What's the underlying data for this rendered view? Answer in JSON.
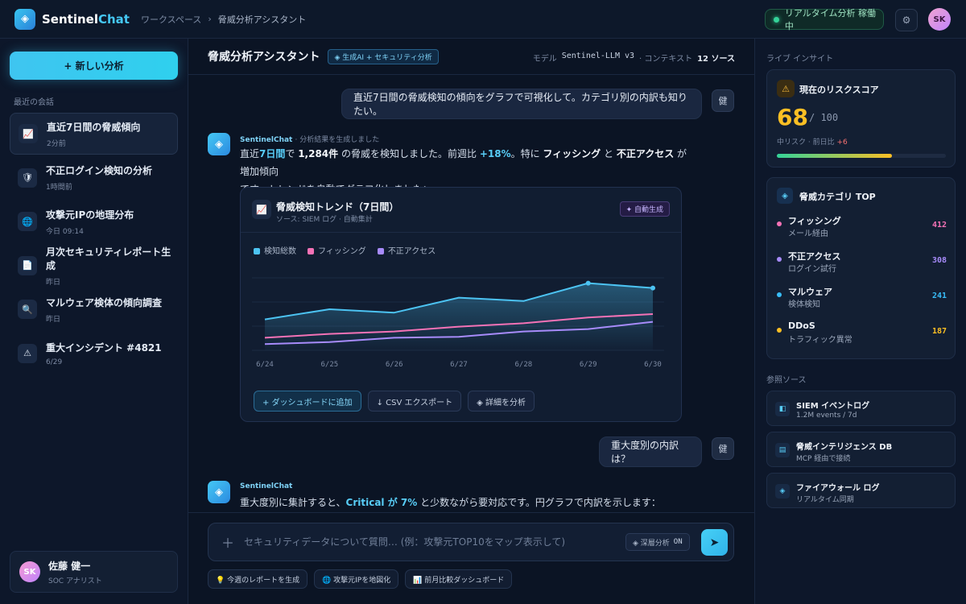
{
  "topbar": {
    "brand_main": "Sentinel",
    "brand_accent": "Chat",
    "breadcrumb": [
      "ワークスペース",
      "脅威分析アシスタント"
    ],
    "breadcrumb_sep": "›",
    "live_status": "リアルタイム分析 稼働中",
    "avatar_initials": "SK"
  },
  "sidebar": {
    "new_button": "+ 新しい分析",
    "section_label": "最近の会話",
    "conversations": [
      {
        "title": "直近7日間の脅威傾向",
        "time": "2分前",
        "icon": "chart-icon",
        "active": true
      },
      {
        "title": "不正ログイン検知の分析",
        "time": "1時間前",
        "icon": "shield-icon"
      },
      {
        "title": "攻撃元IPの地理分布",
        "time": "今日 09:14",
        "icon": "globe-icon"
      },
      {
        "title": "月次セキュリティレポート生成",
        "time": "昨日",
        "icon": "document-icon"
      },
      {
        "title": "マルウェア検体の傾向調査",
        "time": "昨日",
        "icon": "magnifier-icon"
      },
      {
        "title": "重大インシデント #4821",
        "time": "6/29",
        "icon": "warning-icon"
      }
    ],
    "user": {
      "initials": "SK",
      "name": "佐藤 健一",
      "role": "SOC アナリスト"
    }
  },
  "header": {
    "title": "脅威分析アシスタント",
    "badge": "◈ 生成AI + セキュリティ分析",
    "model_label": "モデル",
    "model_name": "Sentinel-LLM v3",
    "context_label": "· コンテキスト",
    "context_count": "12 ソース"
  },
  "messages": {
    "user1": "直近7日間の脅威検知の傾向をグラフで可視化して。カテゴリ別の内訳も知りたい。",
    "user_avatar": "健",
    "ai1_name": "SentinelChat",
    "ai1_sub": "· 分析結果を生成しました",
    "ai1_line1": {
      "a": "直近",
      "b": "7日間",
      "c": "で ",
      "d": "1,284件",
      "e": " の脅威を検知しました。前週比 ",
      "f": "+18%",
      "g": "。特に ",
      "h": "フィッシング",
      "i": " と ",
      "j": "不正アクセス",
      "k": " が増加傾向"
    },
    "ai1_line2": "です。トレンドを自動でグラフ化しました：",
    "user2": "重大度別の内訳は？",
    "ai2_name": "SentinelChat",
    "ai2_text": {
      "a": "重大度別に集計すると、",
      "b": "Critical が 7%",
      "c": " と少数ながら要対応です。円グラフで内訳を示します："
    }
  },
  "chart_card": {
    "title": "脅威検知トレンド（7日間）",
    "subtitle": "ソース: SIEM ログ · 自動集計",
    "badge": "✦ 自動生成",
    "actions": [
      "+ ダッシュボードに追加",
      "↓ CSV エクスポート",
      "◈ 詳細を分析"
    ]
  },
  "chart_data": {
    "type": "area",
    "categories": [
      "6/24",
      "6/25",
      "6/26",
      "6/27",
      "6/28",
      "6/29",
      "6/30"
    ],
    "ylim": [
      0,
      300
    ],
    "grid": true,
    "legend_placement": "top-left",
    "series": [
      {
        "name": "検知総数",
        "color": "#4cc3f2",
        "values": [
          128,
          170,
          156,
          218,
          204,
          278,
          258
        ]
      },
      {
        "name": "フィッシング",
        "color": "#f472b6",
        "values": [
          52,
          68,
          78,
          98,
          112,
          136,
          150
        ]
      },
      {
        "name": "不正アクセス",
        "color": "#a78bfa",
        "values": [
          26,
          34,
          52,
          56,
          78,
          88,
          118
        ]
      }
    ]
  },
  "composer": {
    "placeholder": "セキュリティデータについて質問… (例：攻撃元TOP10をマップ表示して)",
    "deep_label": "◈ 深層分析",
    "deep_state": "ON",
    "send": "➤",
    "chips": [
      "💡 今週のレポートを生成",
      "🌐 攻撃元IPを地図化",
      "📊 前月比較ダッシュボード"
    ]
  },
  "right": {
    "insight_label": "ライブ インサイト",
    "risk": {
      "title": "現在のリスクスコア",
      "score": "68",
      "max": "/ 100",
      "sub": "中リスク · 前日比 ",
      "delta": "+6",
      "level": 0.68
    },
    "categories_title": "脅威カテゴリ TOP",
    "categories": [
      {
        "name": "フィッシング",
        "sub": "メール経由",
        "value": "412",
        "color": "#f472b6"
      },
      {
        "name": "不正アクセス",
        "sub": "ログイン試行",
        "value": "308",
        "color": "#a78bfa"
      },
      {
        "name": "マルウェア",
        "sub": "検体検知",
        "value": "241",
        "color": "#38bdf8"
      },
      {
        "name": "DDoS",
        "sub": "トラフィック異常",
        "value": "187",
        "color": "#fbbf24"
      }
    ],
    "sources_label": "参照ソース",
    "sources": [
      {
        "title": "SIEM イベントログ",
        "sub": "1.2M events / 7d",
        "icon": "server-icon"
      },
      {
        "title": "脅威インテリジェンス DB",
        "sub": "MCP 経由で接続",
        "icon": "database-icon"
      },
      {
        "title": "ファイアウォール ログ",
        "sub": "リアルタイム同期",
        "icon": "firewall-icon"
      }
    ]
  }
}
